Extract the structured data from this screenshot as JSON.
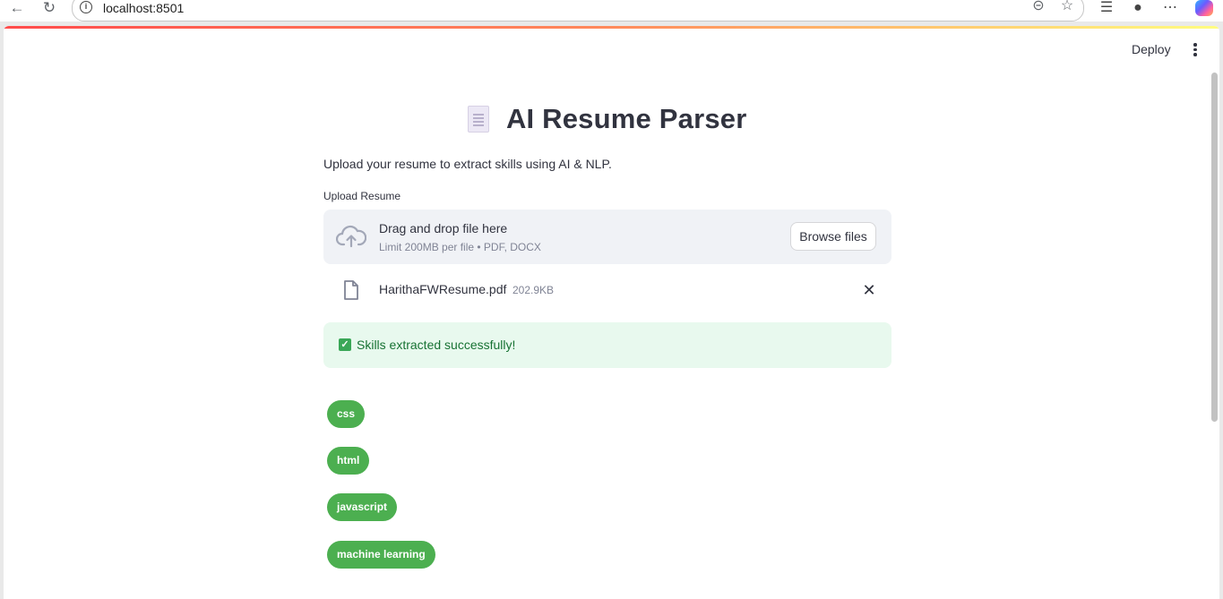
{
  "browser": {
    "url": "localhost:8501"
  },
  "app": {
    "deploy_label": "Deploy",
    "title": "AI Resume Parser",
    "subtitle": "Upload your resume to extract skills using AI & NLP.",
    "upload_label": "Upload Resume",
    "dropzone": {
      "title": "Drag and drop file here",
      "limit": "Limit 200MB per file • PDF, DOCX",
      "browse_label": "Browse files"
    },
    "file": {
      "name": "HarithaFWResume.pdf",
      "size": "202.9KB"
    },
    "alert": {
      "text": "Skills extracted successfully!"
    },
    "skills": [
      "css",
      "html",
      "javascript",
      "machine learning"
    ]
  },
  "colors": {
    "chip": "#4caf50",
    "alert_bg": "#e8f9ee",
    "alert_text": "#177233",
    "accent": "#ff4b4b"
  }
}
